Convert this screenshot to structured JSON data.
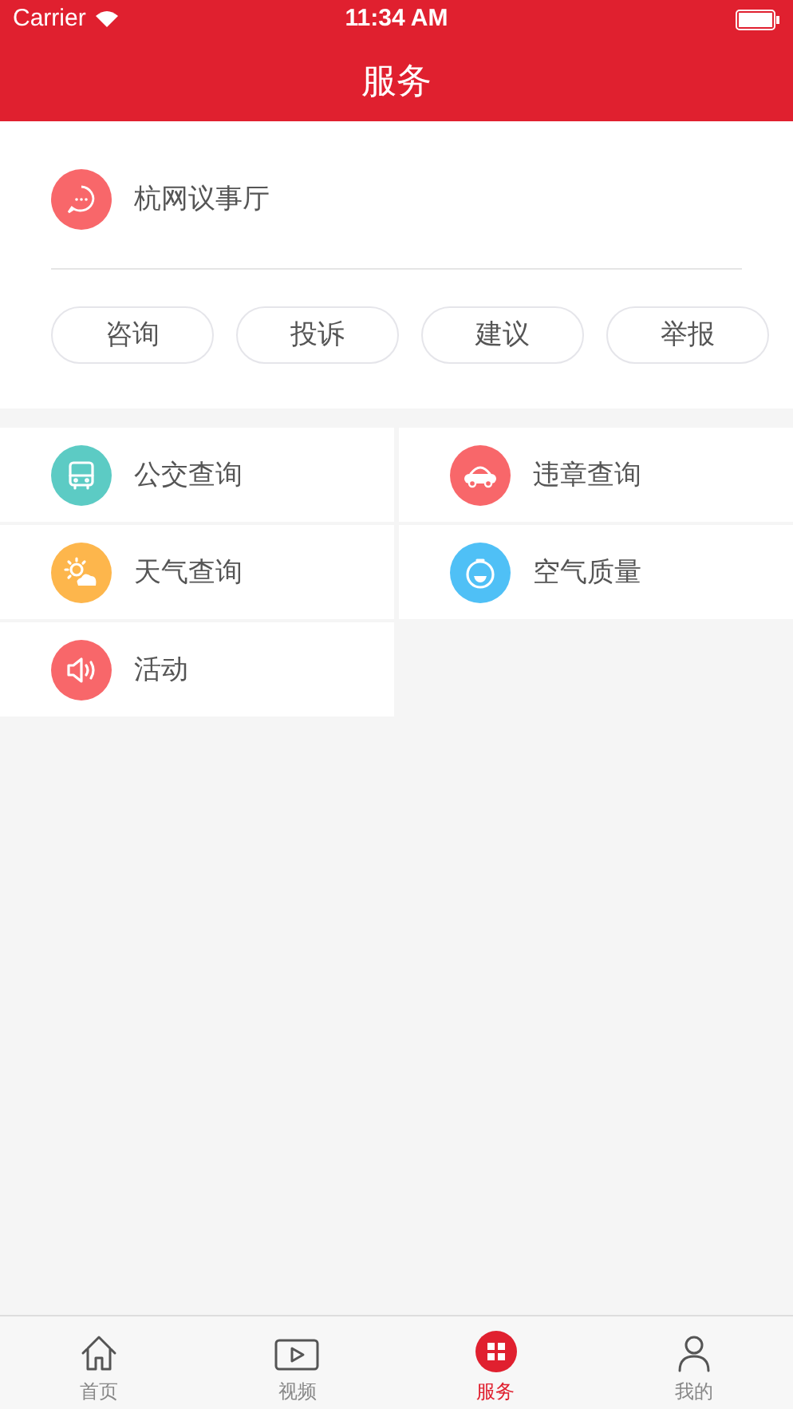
{
  "status_bar": {
    "carrier": "Carrier",
    "time": "11:34 AM"
  },
  "nav": {
    "title": "服务"
  },
  "forum": {
    "title": "杭网议事厅",
    "color": "#f8676a",
    "buttons": [
      "咨询",
      "投诉",
      "建议",
      "举报"
    ]
  },
  "services": [
    {
      "label": "公交查询",
      "kind": "bus",
      "color": "#5ccbc4"
    },
    {
      "label": "违章查询",
      "kind": "car",
      "color": "#f8676a"
    },
    {
      "label": "天气查询",
      "kind": "weather",
      "color": "#fdb64c"
    },
    {
      "label": "空气质量",
      "kind": "air",
      "color": "#4fc0f6"
    },
    {
      "label": "活动",
      "kind": "speaker",
      "color": "#f8676a"
    }
  ],
  "tabs": [
    {
      "label": "首页",
      "kind": "home",
      "selected": false
    },
    {
      "label": "视频",
      "kind": "video",
      "selected": false
    },
    {
      "label": "服务",
      "kind": "grid",
      "selected": true
    },
    {
      "label": "我的",
      "kind": "person",
      "selected": false
    }
  ]
}
